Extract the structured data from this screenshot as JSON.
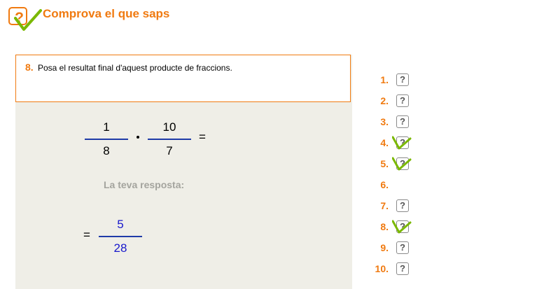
{
  "header": {
    "logo_glyph": "?",
    "title": "Comprova el que saps"
  },
  "question": {
    "number": "8.",
    "prompt": "Posa el resultat final d'aquest producte de fraccions.",
    "fraction_1": {
      "numerator": "1",
      "denominator": "8"
    },
    "operator": "·",
    "fraction_2": {
      "numerator": "10",
      "denominator": "7"
    },
    "equals": "=",
    "response_label": "La teva resposta:",
    "answer_equals": "=",
    "answer": {
      "numerator": "5",
      "denominator": "28"
    }
  },
  "question_list": {
    "items": [
      {
        "label": "1.",
        "glyph": "?",
        "status": "pending"
      },
      {
        "label": "2.",
        "glyph": "?",
        "status": "pending"
      },
      {
        "label": "3.",
        "glyph": "?",
        "status": "pending"
      },
      {
        "label": "4.",
        "glyph": "?",
        "status": "answered"
      },
      {
        "label": "5.",
        "glyph": "?",
        "status": "answered"
      },
      {
        "label": "6.",
        "glyph": "",
        "status": "none"
      },
      {
        "label": "7.",
        "glyph": "?",
        "status": "pending"
      },
      {
        "label": "8.",
        "glyph": "?",
        "status": "answered"
      },
      {
        "label": "9.",
        "glyph": "?",
        "status": "pending"
      },
      {
        "label": "10.",
        "glyph": "?",
        "status": "pending"
      }
    ]
  },
  "colors": {
    "accent": "#f07a10",
    "panel_bg": "#efeee7",
    "fraction_bar": "#1f3ba8",
    "answer_text": "#1818cc",
    "check_green": "#7ab800",
    "muted_label": "#a4a49e"
  },
  "icons": {
    "logo": "question-check-icon",
    "list_pending": "question-box-icon",
    "list_answered": "question-check-icon"
  }
}
